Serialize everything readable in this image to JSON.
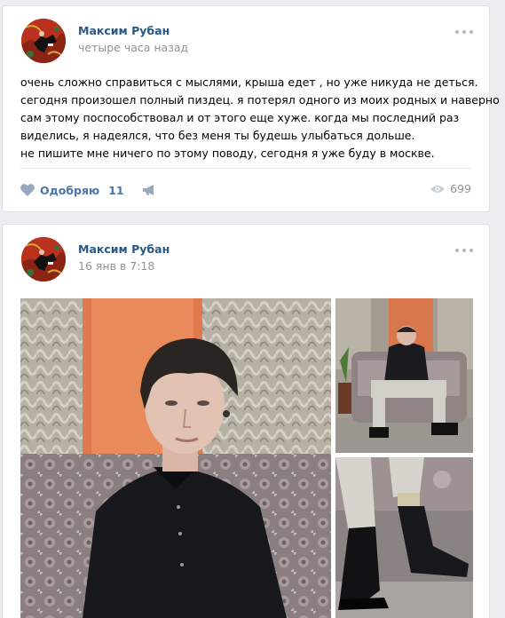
{
  "posts": [
    {
      "author": "Максим Рубан",
      "date": "четыре часа назад",
      "text_lines": [
        "очень сложно справиться с мыслями, крыша едет , но уже никуда не деться.",
        "сегодня произошел полный пиздец. я потерял одного из моих родных и наверно",
        "сам этому поспособствовал и от этого еще хуже. когда мы последний раз",
        "виделись, я надеялся, что без меня ты будешь улыбаться дольше.",
        "не пишите мне ничего по этому поводу, сегодня я уже буду в москве."
      ],
      "like_label": "Одобряю",
      "like_count": "11",
      "views": "699"
    },
    {
      "author": "Максим Рубан",
      "date": "16 янв в 7:18"
    }
  ],
  "colors": {
    "link": "#2a5885",
    "action": "#4a76a8",
    "muted": "#939393",
    "background": "#edeef0"
  },
  "icons": {
    "like": "heart-icon",
    "share": "megaphone-icon",
    "views": "eye-icon",
    "more": "more-dots-icon"
  }
}
